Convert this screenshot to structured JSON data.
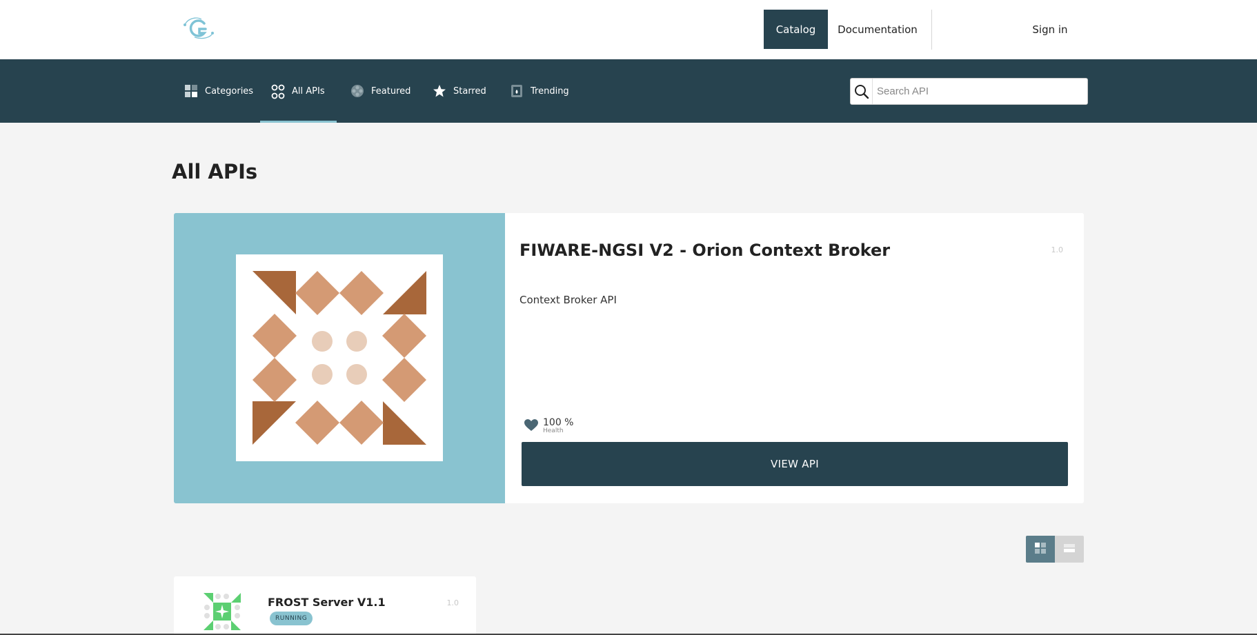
{
  "header": {
    "nav": {
      "catalog": "Catalog",
      "documentation": "Documentation",
      "sign_in": "Sign in"
    }
  },
  "subnav": {
    "tabs": [
      {
        "label": "Categories",
        "icon": "categories-icon"
      },
      {
        "label": "All APIs",
        "icon": "all-apis-icon",
        "active": true
      },
      {
        "label": "Featured",
        "icon": "featured-icon"
      },
      {
        "label": "Starred",
        "icon": "star-icon"
      },
      {
        "label": "Trending",
        "icon": "trending-icon"
      }
    ],
    "search": {
      "placeholder": "Search API",
      "value": ""
    }
  },
  "main": {
    "title": "All APIs",
    "featured_api": {
      "name": "FIWARE-NGSI V2 - Orion Context Broker",
      "version": "1.0",
      "description": "Context Broker API",
      "health_value": "100 %",
      "health_label": "Health",
      "view_button": "VIEW API"
    },
    "apis": [
      {
        "name": "FROST Server V1.1",
        "version": "1.0",
        "status": "RUNNING"
      }
    ]
  },
  "colors": {
    "primary": "#27434f",
    "accent": "#89c3d0",
    "hero_art_dark": "#a8673a",
    "hero_art_light": "#d49a74",
    "hero_art_dot": "#e8cdb9",
    "frost_green": "#5ccf72"
  }
}
